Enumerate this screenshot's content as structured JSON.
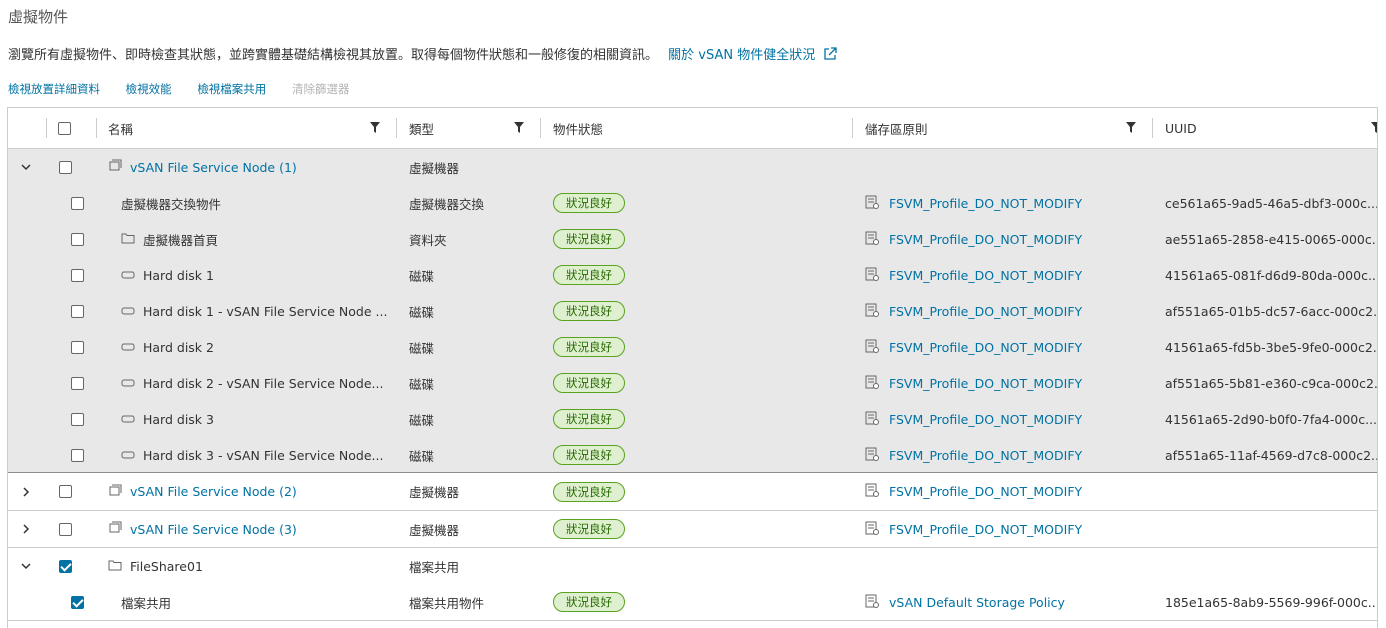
{
  "page": {
    "title": "虛擬物件",
    "description": "瀏覽所有虛擬物件、即時檢查其狀態，並跨實體基礎結構檢視其放置。取得每個物件狀態和一般修復的相關資訊。",
    "help_link": "關於 vSAN 物件健全狀況"
  },
  "actions": {
    "placement": "檢視放置詳細資料",
    "performance": "檢視效能",
    "file_share": "檢視檔案共用",
    "clear_filter": "清除篩選器"
  },
  "columns": {
    "name": "名稱",
    "type": "類型",
    "state": "物件狀態",
    "policy": "儲存區原則",
    "uuid": "UUID"
  },
  "groups": [
    {
      "name": "vSAN File Service Node (1)",
      "type": "虛擬機器",
      "children": [
        {
          "name": "虛擬機器交換物件",
          "type": "虛擬機器交換",
          "state": "狀況良好",
          "policy": "FSVM_Profile_DO_NOT_MODIFY",
          "uuid": "ce561a65-9ad5-46a5-dbf3-000c..."
        },
        {
          "name": "虛擬機器首頁",
          "type": "資料夾",
          "state": "狀況良好",
          "policy": "FSVM_Profile_DO_NOT_MODIFY",
          "uuid": "ae551a65-2858-e415-0065-000c..."
        },
        {
          "name": "Hard disk 1",
          "type": "磁碟",
          "state": "狀況良好",
          "policy": "FSVM_Profile_DO_NOT_MODIFY",
          "uuid": "41561a65-081f-d6d9-80da-000c..."
        },
        {
          "name": "Hard disk 1 - vSAN File Service Node ...",
          "type": "磁碟",
          "state": "狀況良好",
          "policy": "FSVM_Profile_DO_NOT_MODIFY",
          "uuid": "af551a65-01b5-dc57-6acc-000c2..."
        },
        {
          "name": "Hard disk 2",
          "type": "磁碟",
          "state": "狀況良好",
          "policy": "FSVM_Profile_DO_NOT_MODIFY",
          "uuid": "41561a65-fd5b-3be5-9fe0-000c2..."
        },
        {
          "name": "Hard disk 2 - vSAN File Service Node...",
          "type": "磁碟",
          "state": "狀況良好",
          "policy": "FSVM_Profile_DO_NOT_MODIFY",
          "uuid": "af551a65-5b81-e360-c9ca-000c2..."
        },
        {
          "name": "Hard disk 3",
          "type": "磁碟",
          "state": "狀況良好",
          "policy": "FSVM_Profile_DO_NOT_MODIFY",
          "uuid": "41561a65-2d90-b0f0-7fa4-000c..."
        },
        {
          "name": "Hard disk 3 - vSAN File Service Node...",
          "type": "磁碟",
          "state": "狀況良好",
          "policy": "FSVM_Profile_DO_NOT_MODIFY",
          "uuid": "af551a65-11af-4569-d7c8-000c2..."
        }
      ]
    },
    {
      "name": "vSAN File Service Node (2)",
      "type": "虛擬機器",
      "state": "狀況良好",
      "policy": "FSVM_Profile_DO_NOT_MODIFY"
    },
    {
      "name": "vSAN File Service Node (3)",
      "type": "虛擬機器",
      "state": "狀況良好",
      "policy": "FSVM_Profile_DO_NOT_MODIFY"
    },
    {
      "name": "FileShare01",
      "type": "檔案共用",
      "children": [
        {
          "name": "檔案共用",
          "type": "檔案共用物件",
          "state": "狀況良好",
          "policy": "vSAN Default Storage Policy",
          "uuid": "185e1a65-8ab9-5569-996f-000c..."
        }
      ]
    }
  ],
  "icons": {
    "vm": "vm-icon",
    "folder": "folder-icon",
    "disk": "disk-icon",
    "policy": "storage-policy-icon",
    "filter": "filter-icon",
    "external": "external-link-icon",
    "expand": "chevron-right-icon",
    "collapse": "chevron-down-icon"
  },
  "colors": {
    "link": "#0072a3",
    "healthy_bg": "#dff0d0",
    "healthy_border": "#5aa220",
    "selected_row": "#e8e8e8"
  }
}
